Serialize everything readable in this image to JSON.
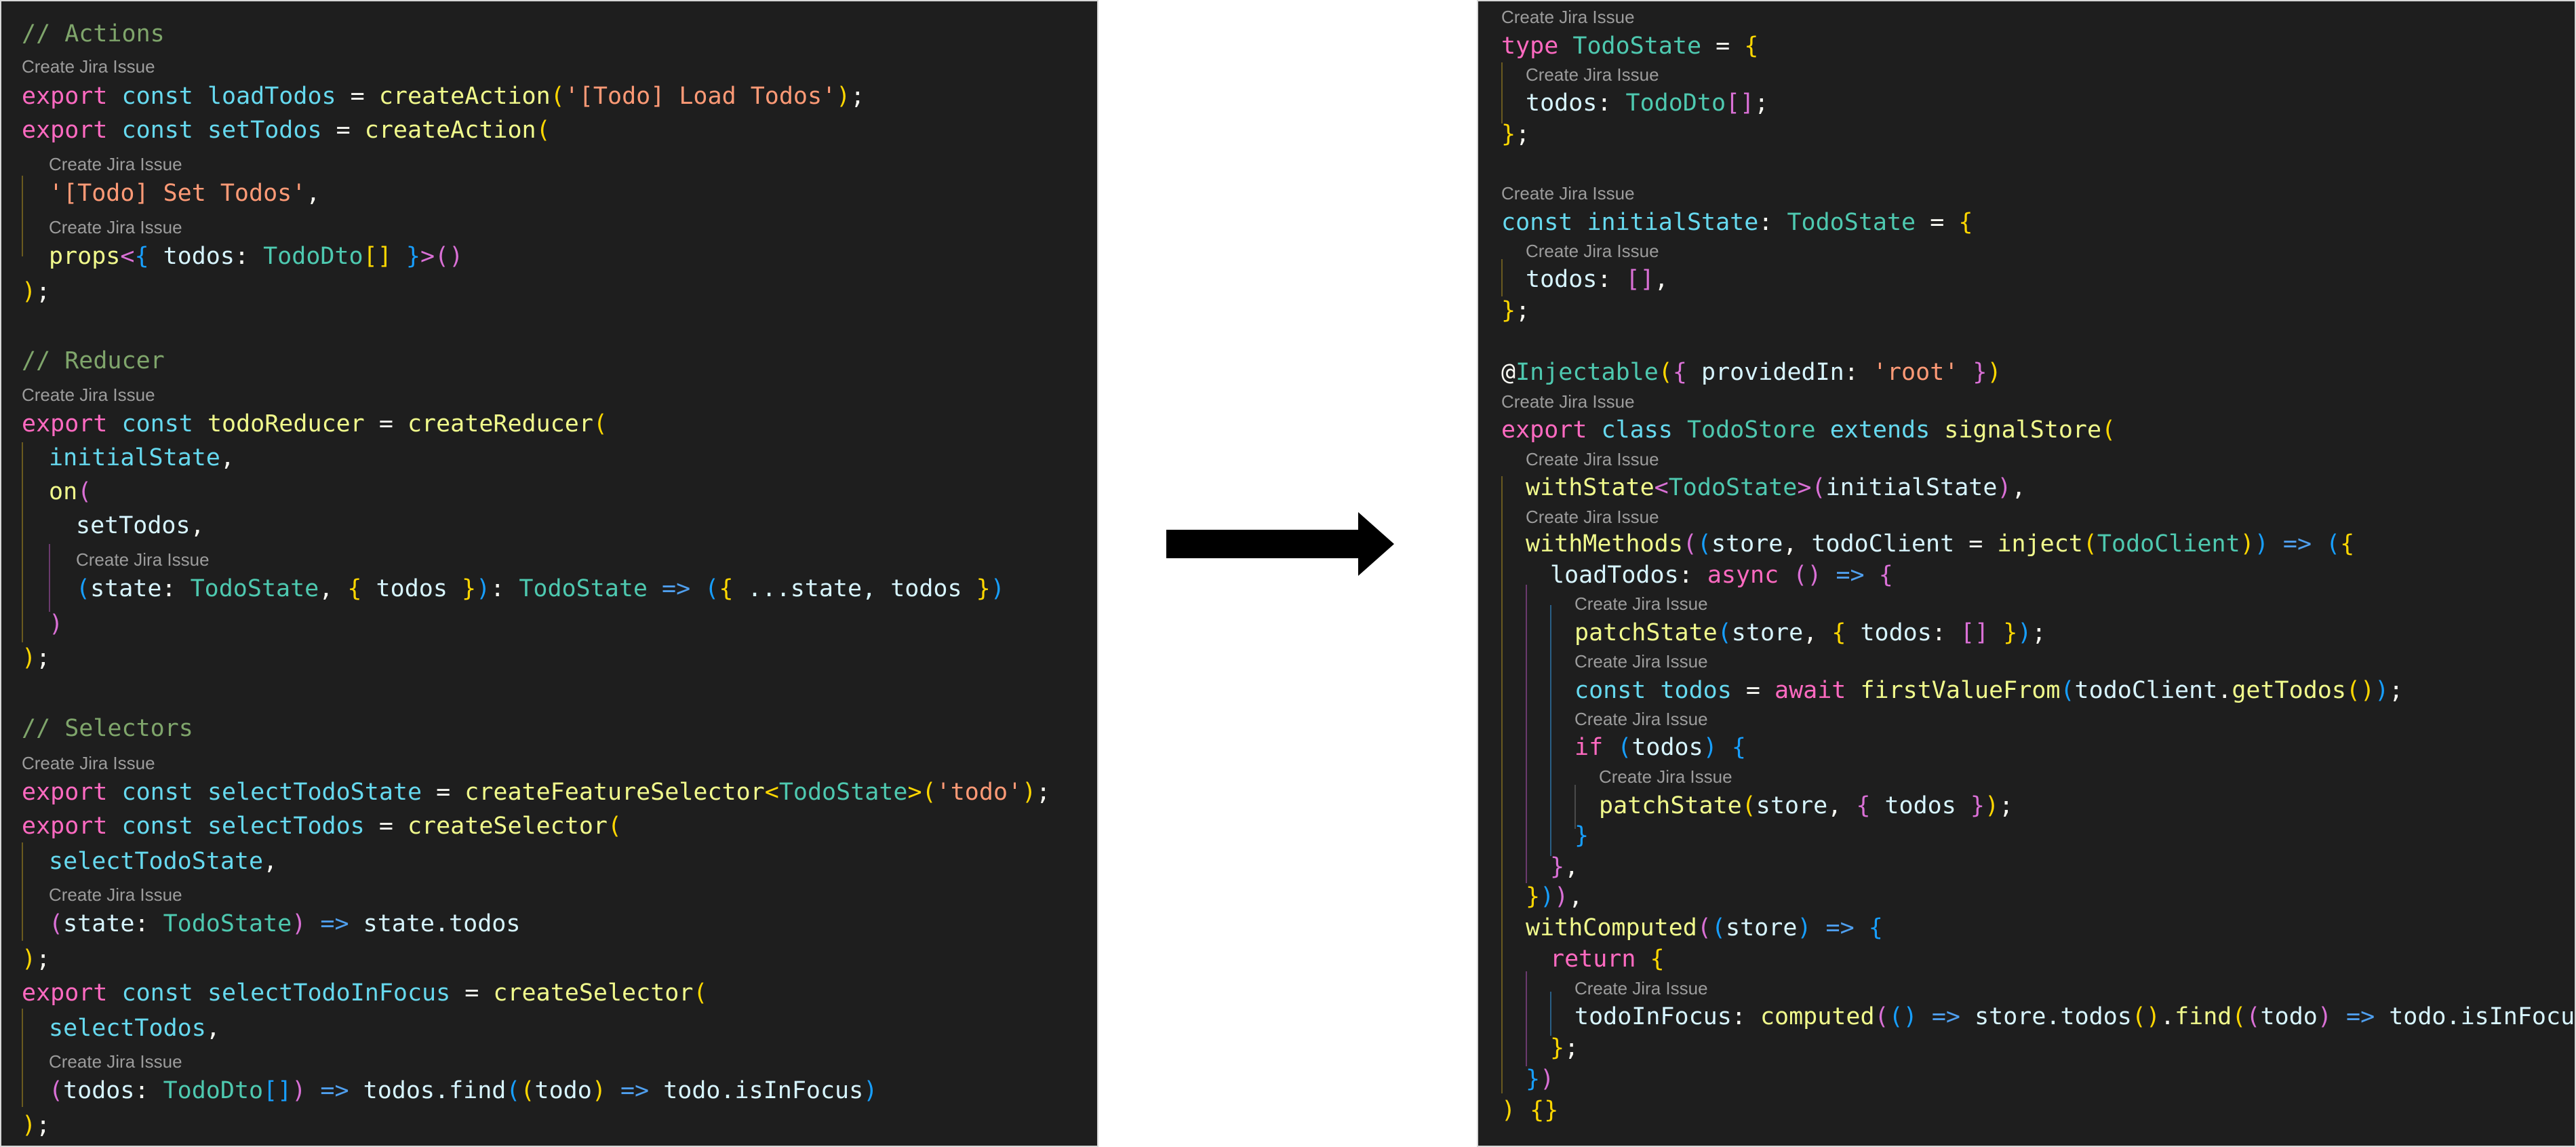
{
  "code_lens_label": "Create Jira Issue",
  "left": {
    "lines": [
      [
        [
          "// Actions",
          "cm"
        ]
      ],
      [
        [
          "export",
          "kw"
        ],
        [
          " ",
          "pl"
        ],
        [
          "const",
          "ty"
        ],
        [
          " ",
          "pl"
        ],
        [
          "loadTodos",
          "ty"
        ],
        [
          " = ",
          "pl"
        ],
        [
          "createAction",
          "fn"
        ],
        [
          "(",
          "b1"
        ],
        [
          "'[Todo] Load Todos'",
          "st"
        ],
        [
          ")",
          "b1"
        ],
        [
          ";",
          "pl"
        ]
      ],
      [
        [
          "export",
          "kw"
        ],
        [
          " ",
          "pl"
        ],
        [
          "const",
          "ty"
        ],
        [
          " ",
          "pl"
        ],
        [
          "setTodos",
          "ty"
        ],
        [
          " = ",
          "pl"
        ],
        [
          "createAction",
          "fn"
        ],
        [
          "(",
          "b1"
        ]
      ],
      [
        [
          "'[Todo] Set Todos'",
          "st"
        ],
        [
          ",",
          "pl"
        ]
      ],
      [
        [
          "props",
          "fn"
        ],
        [
          "<",
          "b2"
        ],
        [
          "{",
          "b3"
        ],
        [
          " todos",
          "vr"
        ],
        [
          ": ",
          "pl"
        ],
        [
          "TodoDto",
          "tt"
        ],
        [
          "[]",
          "b1"
        ],
        [
          " }",
          "b3"
        ],
        [
          ">",
          "b2"
        ],
        [
          "()",
          "b2"
        ]
      ],
      [
        [
          ")",
          "b1"
        ],
        [
          ";",
          "pl"
        ]
      ],
      [
        [
          "// Reducer",
          "cm"
        ]
      ],
      [
        [
          "export",
          "kw"
        ],
        [
          " ",
          "pl"
        ],
        [
          "const",
          "ty"
        ],
        [
          " ",
          "pl"
        ],
        [
          "todoReducer",
          "fn"
        ],
        [
          " = ",
          "pl"
        ],
        [
          "createReducer",
          "fn"
        ],
        [
          "(",
          "b1"
        ]
      ],
      [
        [
          "initialState",
          "ty"
        ],
        [
          ",",
          "pl"
        ]
      ],
      [
        [
          "on",
          "fn"
        ],
        [
          "(",
          "b2"
        ]
      ],
      [
        [
          "setTodos",
          "vr"
        ],
        [
          ",",
          "pl"
        ]
      ],
      [
        [
          "(",
          "b3"
        ],
        [
          "state",
          "vr"
        ],
        [
          ": ",
          "pl"
        ],
        [
          "TodoState",
          "tt"
        ],
        [
          ", ",
          "pl"
        ],
        [
          "{",
          "b1"
        ],
        [
          " todos ",
          "vr"
        ],
        [
          "}",
          "b1"
        ],
        [
          ")",
          "b3"
        ],
        [
          ": ",
          "pl"
        ],
        [
          "TodoState",
          "tt"
        ],
        [
          " => ",
          "ar"
        ],
        [
          "(",
          "b3"
        ],
        [
          "{",
          "b1"
        ],
        [
          " ...state, todos ",
          "vr"
        ],
        [
          "}",
          "b1"
        ],
        [
          ")",
          "b3"
        ]
      ],
      [
        [
          ")",
          "b2"
        ]
      ],
      [
        [
          ")",
          "b1"
        ],
        [
          ";",
          "pl"
        ]
      ],
      [
        [
          "// Selectors",
          "cm"
        ]
      ],
      [
        [
          "export",
          "kw"
        ],
        [
          " ",
          "pl"
        ],
        [
          "const",
          "ty"
        ],
        [
          " ",
          "pl"
        ],
        [
          "selectTodoState",
          "ty"
        ],
        [
          " = ",
          "pl"
        ],
        [
          "createFeatureSelector",
          "fn"
        ],
        [
          "<",
          "b1"
        ],
        [
          "TodoState",
          "tt"
        ],
        [
          ">",
          "b1"
        ],
        [
          "(",
          "b1"
        ],
        [
          "'todo'",
          "st"
        ],
        [
          ")",
          "b1"
        ],
        [
          ";",
          "pl"
        ]
      ],
      [
        [
          "export",
          "kw"
        ],
        [
          " ",
          "pl"
        ],
        [
          "const",
          "ty"
        ],
        [
          " ",
          "pl"
        ],
        [
          "selectTodos",
          "ty"
        ],
        [
          " = ",
          "pl"
        ],
        [
          "createSelector",
          "fn"
        ],
        [
          "(",
          "b1"
        ]
      ],
      [
        [
          "selectTodoState",
          "ty"
        ],
        [
          ",",
          "pl"
        ]
      ],
      [
        [
          "(",
          "b2"
        ],
        [
          "state",
          "vr"
        ],
        [
          ": ",
          "pl"
        ],
        [
          "TodoState",
          "tt"
        ],
        [
          ")",
          "b2"
        ],
        [
          " => ",
          "ar"
        ],
        [
          "state.todos",
          "vr"
        ]
      ],
      [
        [
          ")",
          "b1"
        ],
        [
          ";",
          "pl"
        ]
      ],
      [
        [
          "export",
          "kw"
        ],
        [
          " ",
          "pl"
        ],
        [
          "const",
          "ty"
        ],
        [
          " ",
          "pl"
        ],
        [
          "selectTodoInFocus",
          "ty"
        ],
        [
          " = ",
          "pl"
        ],
        [
          "createSelector",
          "fn"
        ],
        [
          "(",
          "b1"
        ]
      ],
      [
        [
          "selectTodos",
          "ty"
        ],
        [
          ",",
          "pl"
        ]
      ],
      [
        [
          "(",
          "b2"
        ],
        [
          "todos",
          "vr"
        ],
        [
          ": ",
          "pl"
        ],
        [
          "TodoDto",
          "tt"
        ],
        [
          "[]",
          "b3"
        ],
        [
          ")",
          "b2"
        ],
        [
          " => ",
          "ar"
        ],
        [
          "todos.find",
          "vr"
        ],
        [
          "(",
          "b3"
        ],
        [
          "(",
          "b1"
        ],
        [
          "todo",
          "vr"
        ],
        [
          ")",
          "b1"
        ],
        [
          " => ",
          "ar"
        ],
        [
          "todo.isInFocus",
          "vr"
        ],
        [
          ")",
          "b3"
        ]
      ],
      [
        [
          ")",
          "b1"
        ],
        [
          ";",
          "pl"
        ]
      ]
    ]
  },
  "right": {
    "lines": [
      [
        [
          "type",
          "kw"
        ],
        [
          " ",
          "pl"
        ],
        [
          "TodoState",
          "tt"
        ],
        [
          " = ",
          "pl"
        ],
        [
          "{",
          "b1"
        ]
      ],
      [
        [
          "todos",
          "vr"
        ],
        [
          ": ",
          "pl"
        ],
        [
          "TodoDto",
          "tt"
        ],
        [
          "[]",
          "b2"
        ],
        [
          ";",
          "pl"
        ]
      ],
      [
        [
          "}",
          "b1"
        ],
        [
          ";",
          "pl"
        ]
      ],
      [
        [
          "const",
          "ty"
        ],
        [
          " ",
          "pl"
        ],
        [
          "initialState",
          "ty"
        ],
        [
          ": ",
          "pl"
        ],
        [
          "TodoState",
          "tt"
        ],
        [
          " = ",
          "pl"
        ],
        [
          "{",
          "b1"
        ]
      ],
      [
        [
          "todos",
          "vr"
        ],
        [
          ": ",
          "pl"
        ],
        [
          "[]",
          "b2"
        ],
        [
          ",",
          "pl"
        ]
      ],
      [
        [
          "}",
          "b1"
        ],
        [
          ";",
          "pl"
        ]
      ],
      [
        [
          "@",
          "pl"
        ],
        [
          "Injectable",
          "tt"
        ],
        [
          "(",
          "b1"
        ],
        [
          "{",
          "b2"
        ],
        [
          " providedIn",
          "vr"
        ],
        [
          ": ",
          "pl"
        ],
        [
          "'root'",
          "st"
        ],
        [
          " }",
          "b2"
        ],
        [
          ")",
          "b1"
        ]
      ],
      [
        [
          "export",
          "kw"
        ],
        [
          " ",
          "pl"
        ],
        [
          "class",
          "ty"
        ],
        [
          " ",
          "pl"
        ],
        [
          "TodoStore",
          "tt"
        ],
        [
          " ",
          "pl"
        ],
        [
          "extends",
          "ty"
        ],
        [
          " ",
          "pl"
        ],
        [
          "signalStore",
          "fn"
        ],
        [
          "(",
          "b1"
        ]
      ],
      [
        [
          "withState",
          "fn"
        ],
        [
          "<",
          "b2"
        ],
        [
          "TodoState",
          "tt"
        ],
        [
          ">",
          "b2"
        ],
        [
          "(",
          "b2"
        ],
        [
          "initialState",
          "vr"
        ],
        [
          ")",
          "b2"
        ],
        [
          ",",
          "pl"
        ]
      ],
      [
        [
          "withMethods",
          "fn"
        ],
        [
          "(",
          "b2"
        ],
        [
          "(",
          "b3"
        ],
        [
          "store",
          "vr"
        ],
        [
          ", ",
          "pl"
        ],
        [
          "todoClient",
          "vr"
        ],
        [
          " = ",
          "pl"
        ],
        [
          "inject",
          "fn"
        ],
        [
          "(",
          "b1"
        ],
        [
          "TodoClient",
          "tt"
        ],
        [
          ")",
          "b1"
        ],
        [
          ")",
          "b3"
        ],
        [
          " => ",
          "ar"
        ],
        [
          "(",
          "b3"
        ],
        [
          "{",
          "b1"
        ]
      ],
      [
        [
          "loadTodos",
          "vr"
        ],
        [
          ": ",
          "pl"
        ],
        [
          "async",
          "kw"
        ],
        [
          " ",
          "pl"
        ],
        [
          "()",
          "b2"
        ],
        [
          " => ",
          "ar"
        ],
        [
          "{",
          "b2"
        ]
      ],
      [
        [
          "patchState",
          "fn"
        ],
        [
          "(",
          "b3"
        ],
        [
          "store",
          "vr"
        ],
        [
          ", ",
          "pl"
        ],
        [
          "{",
          "b1"
        ],
        [
          " todos",
          "vr"
        ],
        [
          ": ",
          "pl"
        ],
        [
          "[]",
          "b2"
        ],
        [
          " }",
          "b1"
        ],
        [
          ")",
          "b3"
        ],
        [
          ";",
          "pl"
        ]
      ],
      [
        [
          "const",
          "ty"
        ],
        [
          " ",
          "pl"
        ],
        [
          "todos",
          "ty"
        ],
        [
          " = ",
          "pl"
        ],
        [
          "await",
          "kw"
        ],
        [
          " ",
          "pl"
        ],
        [
          "firstValueFrom",
          "fn"
        ],
        [
          "(",
          "b3"
        ],
        [
          "todoClient",
          "vr"
        ],
        [
          ".",
          "pl"
        ],
        [
          "getTodos",
          "fn"
        ],
        [
          "()",
          "b1"
        ],
        [
          ")",
          "b3"
        ],
        [
          ";",
          "pl"
        ]
      ],
      [
        [
          "if",
          "kw"
        ],
        [
          " ",
          "pl"
        ],
        [
          "(",
          "b3"
        ],
        [
          "todos",
          "vr"
        ],
        [
          ")",
          "b3"
        ],
        [
          " ",
          "pl"
        ],
        [
          "{",
          "b3"
        ]
      ],
      [
        [
          "patchState",
          "fn"
        ],
        [
          "(",
          "b1"
        ],
        [
          "store",
          "vr"
        ],
        [
          ", ",
          "pl"
        ],
        [
          "{",
          "b2"
        ],
        [
          " todos ",
          "vr"
        ],
        [
          "}",
          "b2"
        ],
        [
          ")",
          "b1"
        ],
        [
          ";",
          "pl"
        ]
      ],
      [
        [
          "}",
          "b3"
        ]
      ],
      [
        [
          "}",
          "b2"
        ],
        [
          ",",
          "pl"
        ]
      ],
      [
        [
          "}",
          "b1"
        ],
        [
          ")",
          "b3"
        ],
        [
          ")",
          "b2"
        ],
        [
          ",",
          "pl"
        ]
      ],
      [
        [
          "withComputed",
          "fn"
        ],
        [
          "(",
          "b2"
        ],
        [
          "(",
          "b3"
        ],
        [
          "store",
          "vr"
        ],
        [
          ")",
          "b3"
        ],
        [
          " => ",
          "ar"
        ],
        [
          "{",
          "b3"
        ]
      ],
      [
        [
          "return",
          "kw"
        ],
        [
          " ",
          "pl"
        ],
        [
          "{",
          "b1"
        ]
      ],
      [
        [
          "todoInFocus",
          "vr"
        ],
        [
          ": ",
          "pl"
        ],
        [
          "computed",
          "fn"
        ],
        [
          "(",
          "b2"
        ],
        [
          "()",
          "b3"
        ],
        [
          " => ",
          "ar"
        ],
        [
          "store.todos",
          "vr"
        ],
        [
          "()",
          "b1"
        ],
        [
          ".",
          "pl"
        ],
        [
          "find",
          "fn"
        ],
        [
          "(",
          "b1"
        ],
        [
          "(",
          "b2"
        ],
        [
          "todo",
          "vr"
        ],
        [
          ")",
          "b2"
        ],
        [
          " => ",
          "ar"
        ],
        [
          "todo.isInFocus",
          "vr"
        ],
        [
          ")",
          "b1"
        ],
        [
          ")",
          "b2"
        ],
        [
          ",",
          "pl"
        ]
      ],
      [
        [
          "}",
          "b1"
        ],
        [
          ";",
          "pl"
        ]
      ],
      [
        [
          "}",
          "b3"
        ],
        [
          ")",
          "b2"
        ]
      ],
      [
        [
          ")",
          "b1"
        ],
        [
          " ",
          "pl"
        ],
        [
          "{}",
          "b1"
        ]
      ]
    ]
  }
}
